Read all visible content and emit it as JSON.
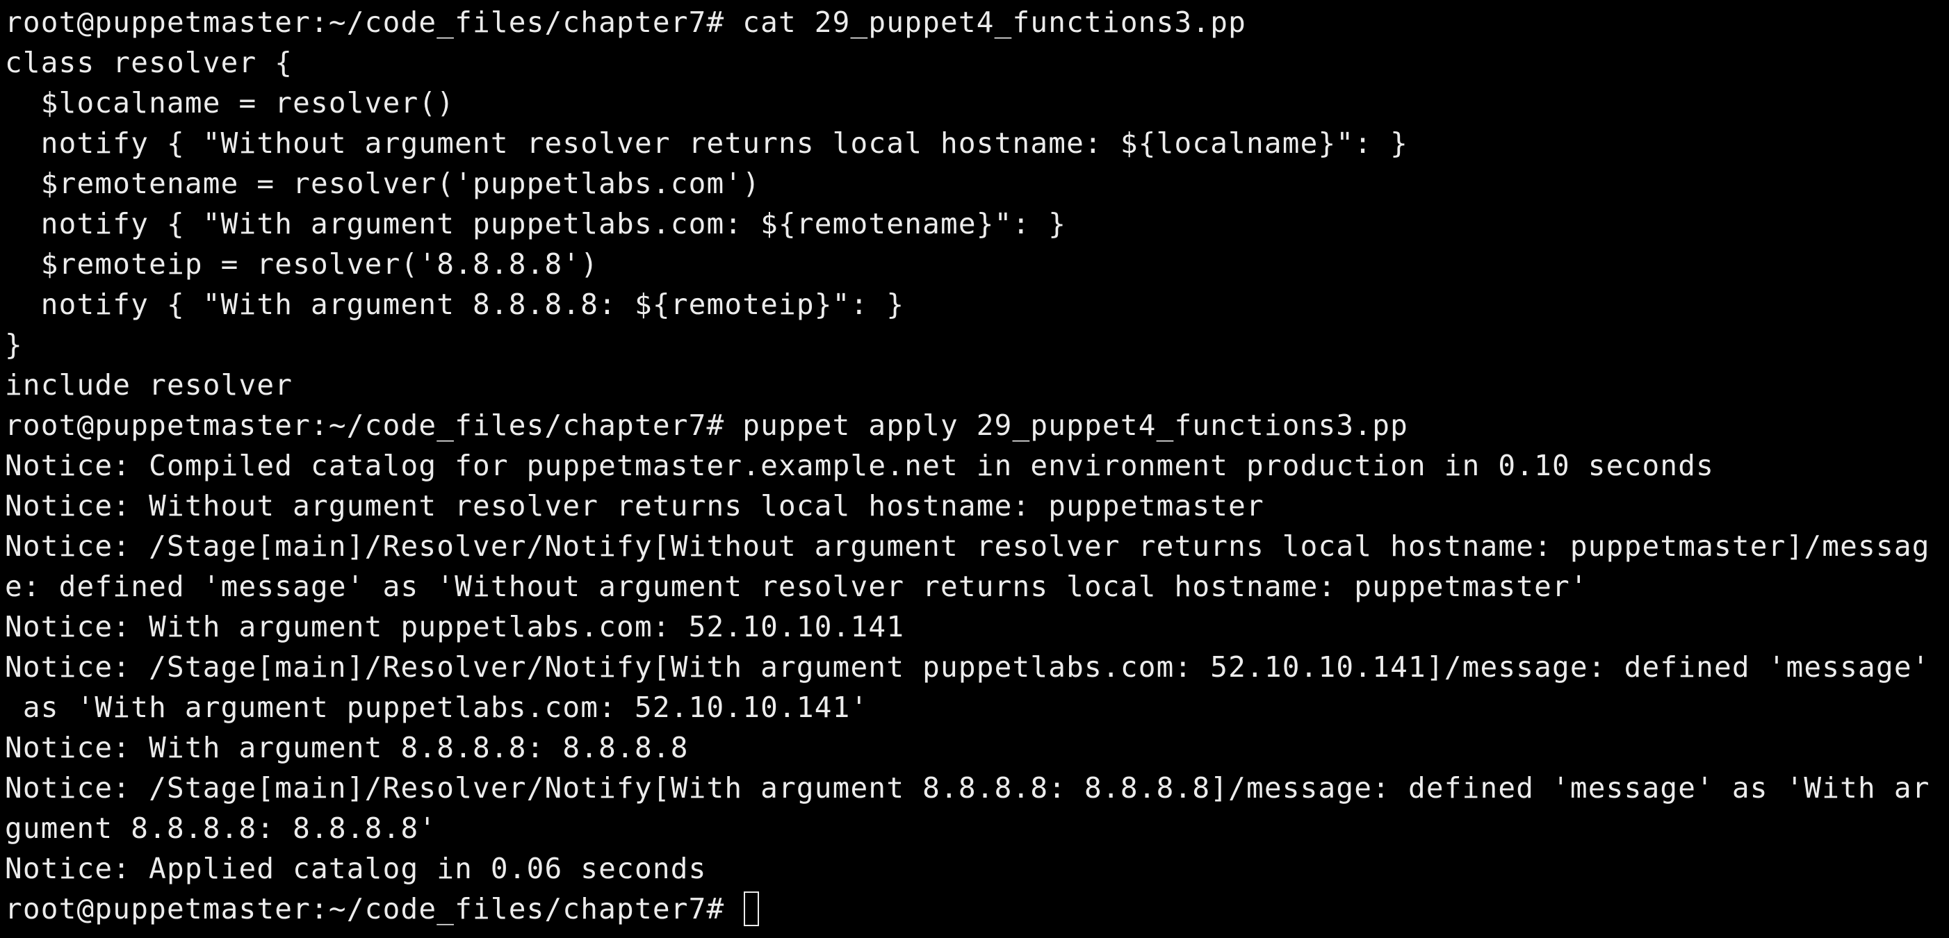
{
  "colors": {
    "background": "#000000",
    "text": "#ececec"
  },
  "terminal": {
    "lines": [
      "root@puppetmaster:~/code_files/chapter7# cat 29_puppet4_functions3.pp",
      "class resolver {",
      "  $localname = resolver()",
      "  notify { \"Without argument resolver returns local hostname: ${localname}\": }",
      "  $remotename = resolver('puppetlabs.com')",
      "  notify { \"With argument puppetlabs.com: ${remotename}\": }",
      "  $remoteip = resolver('8.8.8.8')",
      "  notify { \"With argument 8.8.8.8: ${remoteip}\": }",
      "}",
      "include resolver",
      "root@puppetmaster:~/code_files/chapter7# puppet apply 29_puppet4_functions3.pp",
      "Notice: Compiled catalog for puppetmaster.example.net in environment production in 0.10 seconds",
      "Notice: Without argument resolver returns local hostname: puppetmaster",
      "Notice: /Stage[main]/Resolver/Notify[Without argument resolver returns local hostname: puppetmaster]/messag",
      "e: defined 'message' as 'Without argument resolver returns local hostname: puppetmaster'",
      "Notice: With argument puppetlabs.com: 52.10.10.141",
      "Notice: /Stage[main]/Resolver/Notify[With argument puppetlabs.com: 52.10.10.141]/message: defined 'message'",
      " as 'With argument puppetlabs.com: 52.10.10.141'",
      "Notice: With argument 8.8.8.8: 8.8.8.8",
      "Notice: /Stage[main]/Resolver/Notify[With argument 8.8.8.8: 8.8.8.8]/message: defined 'message' as 'With ar",
      "gument 8.8.8.8: 8.8.8.8'",
      "Notice: Applied catalog in 0.06 seconds"
    ],
    "prompt": "root@puppetmaster:~/code_files/chapter7# "
  }
}
